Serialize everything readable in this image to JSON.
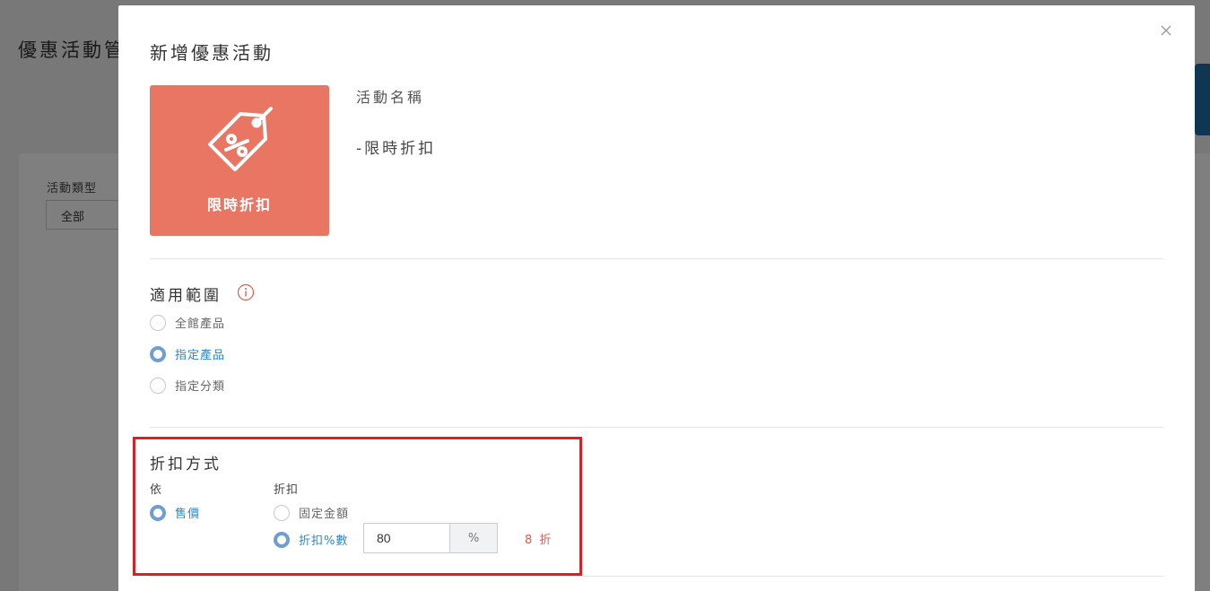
{
  "background": {
    "page_title": "優惠活動管",
    "filter_label": "活動類型",
    "filter_value": "全部"
  },
  "modal": {
    "title": "新增優惠活動",
    "close_icon": "close-icon",
    "activity_card": {
      "icon": "discount-tag-icon",
      "label": "限時折扣",
      "color": "#e97563"
    },
    "name_label": "活動名稱",
    "name_value": "-限時折扣",
    "scope": {
      "title": "適用範圍",
      "info_icon": "info-icon",
      "options": [
        {
          "label": "全館產品",
          "selected": false
        },
        {
          "label": "指定產品",
          "selected": true
        },
        {
          "label": "指定分類",
          "selected": false
        }
      ]
    },
    "discount_method": {
      "title": "折扣方式",
      "basis_label": "依",
      "basis_options": [
        {
          "label": "售價",
          "selected": true
        }
      ],
      "discount_label": "折扣",
      "discount_options": [
        {
          "label": "固定金額",
          "selected": false
        },
        {
          "label": "折扣%數",
          "selected": true
        }
      ],
      "input_value": "80",
      "unit": "%",
      "result": "8 折"
    }
  },
  "colors": {
    "accent_blue": "#2a88c8",
    "radio_blue": "#6f9ed3",
    "highlight_red": "#d0242a",
    "result_red": "#e05a4f"
  }
}
